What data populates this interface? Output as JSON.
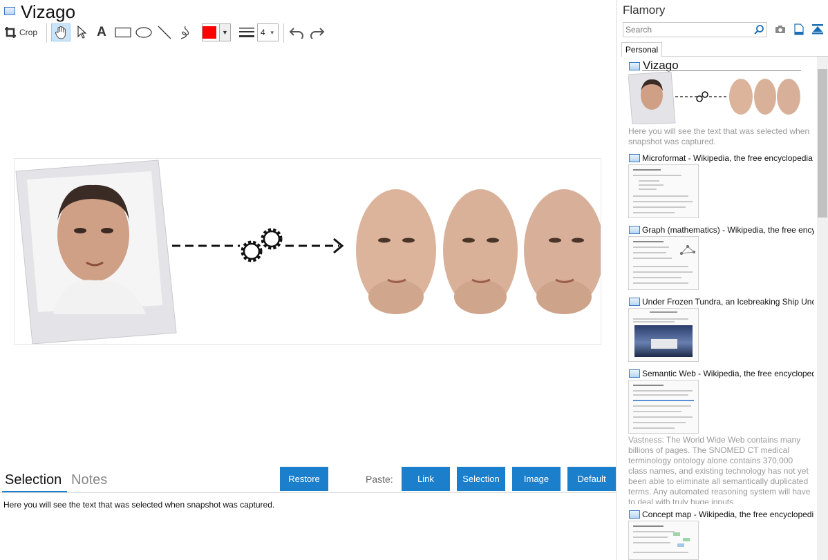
{
  "app": {
    "title": "Vizago"
  },
  "toolbar": {
    "crop_label": "Crop",
    "line_width_value": "4",
    "stroke_color": "#ff0000"
  },
  "bottom": {
    "tabs": [
      {
        "label": "Selection",
        "active": true
      },
      {
        "label": "Notes",
        "active": false
      }
    ],
    "restore_label": "Restore",
    "paste_label": "Paste:",
    "paste_buttons": [
      "Link",
      "Selection",
      "Image",
      "Default"
    ],
    "notes_text": "Here you will see the text that was selected when snapshot was captured."
  },
  "flamory": {
    "title": "Flamory",
    "search_placeholder": "Search",
    "tab_label": "Personal",
    "entries": [
      {
        "title": "Vizago",
        "caption": "Here you will see the text that was selected when snapshot was captured."
      },
      {
        "title": "Microformat - Wikipedia, the free encyclopedia"
      },
      {
        "title": "Graph (mathematics) - Wikipedia, the free encyc"
      },
      {
        "title": "Under Frozen Tundra, an Icebreaking Ship Unco"
      },
      {
        "title": "Semantic Web - Wikipedia, the free encycloped",
        "caption": "Vastness: The World Wide Web contains many billions of pages. The SNOMED CT medical terminology ontology alone contains 370,000 class names, and existing technology has not yet been able to eliminate all semantically duplicated terms. Any automated reasoning system will have to deal with truly huge inputs."
      },
      {
        "title": "Concept map - Wikipedia, the free encyclopedi"
      }
    ]
  },
  "colors": {
    "accent": "#1b7fcc",
    "stroke": "#ff0000"
  }
}
